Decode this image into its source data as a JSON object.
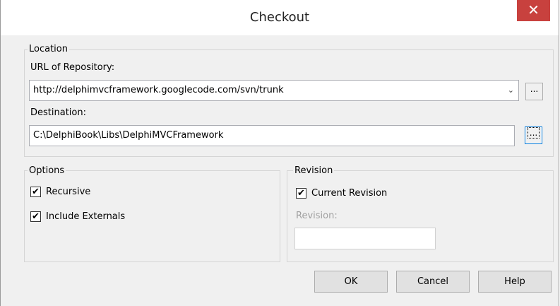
{
  "window": {
    "title": "Checkout",
    "close_glyph": "✕"
  },
  "location": {
    "legend": "Location",
    "url_label": "URL of Repository:",
    "url_value": "http://delphimvcframework.googlecode.com/svn/trunk",
    "url_browse": "...",
    "dest_label": "Destination:",
    "dest_value": "C:\\DelphiBook\\Libs\\DelphiMVCFramework",
    "dest_browse": "..."
  },
  "options": {
    "legend": "Options",
    "recursive": {
      "label": "Recursive",
      "checked": true
    },
    "externals": {
      "label": "Include Externals",
      "checked": true
    }
  },
  "revision": {
    "legend": "Revision",
    "current": {
      "label": "Current Revision",
      "checked": true
    },
    "revision_label": "Revision:",
    "revision_value": ""
  },
  "buttons": {
    "ok": "OK",
    "cancel": "Cancel",
    "help": "Help"
  },
  "icons": {
    "check": "✔",
    "dropdown": "⌄"
  }
}
